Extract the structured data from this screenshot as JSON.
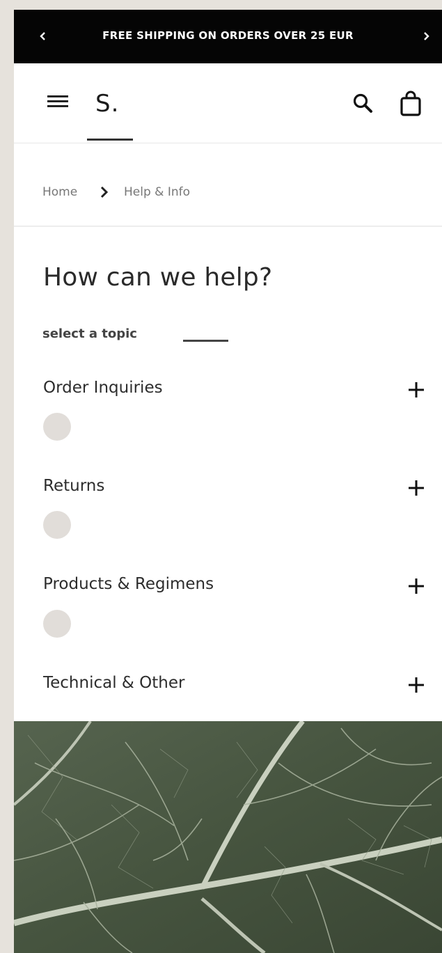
{
  "promo": {
    "text": "FREE SHIPPING ON ORDERS OVER 25 EUR",
    "prev_icon": "chevron-left-icon",
    "next_icon": "chevron-right-icon"
  },
  "header": {
    "logo": "S.",
    "menu_icon": "hamburger-menu-icon",
    "search_icon": "search-icon",
    "bag_icon": "shopping-bag-icon"
  },
  "breadcrumb": {
    "items": [
      "Home",
      "Help & Info"
    ],
    "separator_icon": "chevron-right-icon"
  },
  "help": {
    "title": "How can we help?",
    "subtitle": "select a topic",
    "topics": [
      {
        "label": "Order Inquiries"
      },
      {
        "label": "Returns"
      },
      {
        "label": "Products & Regimens"
      },
      {
        "label": "Technical & Other"
      }
    ],
    "expand_icon": "plus-icon"
  },
  "colors": {
    "promo_background": "#050505",
    "page_background": "#ffffff",
    "outer_background": "#e6e2dc",
    "dot_color": "#e1ddd9",
    "text_dark": "#2d2d2d",
    "leaf_green": "#4a5a45"
  }
}
